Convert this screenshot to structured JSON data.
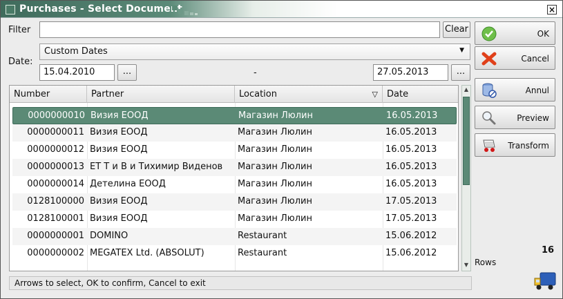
{
  "window": {
    "title": "Purchases - Select Document"
  },
  "filter": {
    "label": "Filter",
    "value": "",
    "clear_label": "Clear"
  },
  "date": {
    "label": "Date:",
    "mode": "Custom Dates",
    "from": "15.04.2010",
    "separator": "-",
    "to": "27.05.2013",
    "browse_label": "..."
  },
  "table": {
    "columns": [
      "Number",
      "Partner",
      "Location",
      "Date"
    ],
    "rows": [
      [
        "0000000010",
        "Визия ЕООД",
        "Магазин Люлин",
        "16.05.2013"
      ],
      [
        "0000000011",
        "Визия ЕООД",
        "Магазин Люлин",
        "16.05.2013"
      ],
      [
        "0000000012",
        "Визия ЕООД",
        "Магазин Люлин",
        "16.05.2013"
      ],
      [
        "0000000013",
        "ЕТ Т и В и Тихимир Виденов",
        "Магазин Люлин",
        "16.05.2013"
      ],
      [
        "0000000014",
        "Детелина ЕООД",
        "Магазин Люлин",
        "16.05.2013"
      ],
      [
        "0128100000",
        "Визия ЕООД",
        "Магазин Люлин",
        "17.05.2013"
      ],
      [
        "0128100001",
        "Визия ЕООД",
        "Магазин Люлин",
        "17.05.2013"
      ],
      [
        "0000000001",
        "DOMINO",
        "Restaurant",
        "15.06.2012"
      ],
      [
        "0000000002",
        "MEGATEX Ltd. (ABSOLUT)",
        "Restaurant",
        "15.06.2012"
      ]
    ],
    "selected_row": 0
  },
  "status_text": "Arrows to select, OK to confirm, Cancel to exit",
  "actions": {
    "ok": "OK",
    "cancel": "Cancel",
    "annul": "Annul",
    "preview": "Preview",
    "transform": "Transform"
  },
  "rows_info": {
    "count": "16",
    "label": "Rows"
  },
  "colors": {
    "accent": "#5b8a76",
    "selection": "#5b8a76"
  }
}
